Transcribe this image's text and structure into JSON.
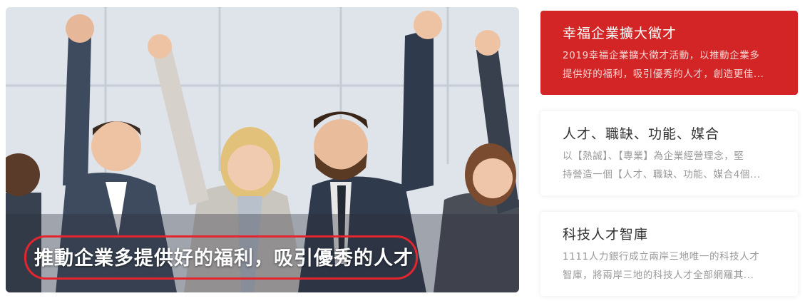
{
  "hero": {
    "caption": "推動企業多提供好的福利，吸引優秀的人才"
  },
  "cards": [
    {
      "title": "幸福企業擴大徵才",
      "desc_line1": "2019幸福企業擴大徵才活動，以推動企業多",
      "desc_line2": "提供好的福利，吸引優秀的人才，創造更佳..."
    },
    {
      "title": "人才、職缺、功能、媒合",
      "desc_line1": "以【熱誠】、【專業】為企業經營理念，堅",
      "desc_line2": "持營造一個【人才、職缺、功能、媒合4個..."
    },
    {
      "title": "科技人才智庫",
      "desc_line1": "1111人力銀行成立兩岸三地唯一的科技人才",
      "desc_line2": "智庫，將兩岸三地的科技人才全部網羅其..."
    }
  ],
  "colors": {
    "active_card": "#d32525",
    "caption_highlight": "#e3262d"
  }
}
